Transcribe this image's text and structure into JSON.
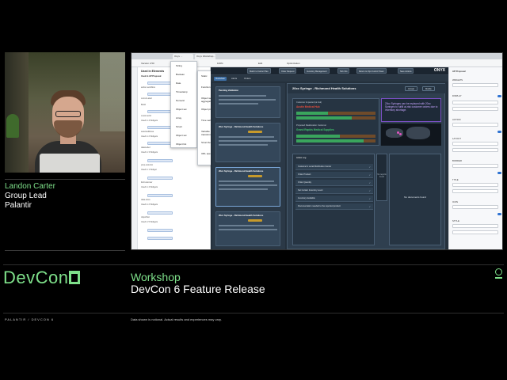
{
  "speaker": {
    "name": "Landon Carter",
    "role": "Group Lead",
    "company": "Palantir"
  },
  "event": {
    "logo_text": "DevCon",
    "session_type": "Workshop",
    "session_title": "DevCon 6 Feature Release"
  },
  "footer": {
    "brand": "PALANTIR  /  DEVCON 6",
    "disclaimer": "Data shown is notional. Actual results and experiences may vary."
  },
  "colors": {
    "accent": "#7ee08a",
    "background": "#000000"
  },
  "screen": {
    "browser_tabs": [
      "Onyx ...",
      "Onyx Workshop..."
    ],
    "toolbar": {
      "version": "Version 2.50",
      "zoom": "100%",
      "edit_label": "Edit",
      "optimization_label": "Optimization"
    },
    "left_panel": {
      "title": "Used in Elements",
      "section": "Used in AP Proposal",
      "rows": [
        "action-workflow",
        "current-alert",
        "Build",
        "customerId",
        "Used in 4 Widgets",
        "selectedRows",
        "Used in 2 Widgets",
        "dateLabel",
        "Used in 3 Widgets",
        "prop-selector",
        "Used in 1 Widget",
        "listCustomer",
        "Used in 4 Widgets",
        "data-store",
        "Used in 2 Widgets",
        "objectSet",
        "Used in 5 Widgets"
      ]
    },
    "context_menu": {
      "items": [
        "String",
        "Boolean",
        "Date",
        "Timestamp",
        "Numeric",
        "Object set",
        "Array",
        "Struct",
        "Object set",
        "Object list"
      ]
    },
    "submenu": {
      "items": [
        "Static",
        "Function",
        "Object set aggregation",
        "Object property",
        "Time series",
        "Variable transformation",
        "Struct field",
        "URL query"
      ]
    },
    "app": {
      "tabs": [
        "Overview",
        "Alerts",
        "Orders"
      ],
      "nav_pills": [
        "Match to Carrier Plan",
        "Order Request",
        "Inventory Management",
        "Hub Info",
        "Return to Ops Control Tower",
        "Save Actions"
      ],
      "brand": "ONYX",
      "panel_title": "AP Proposal",
      "sidebar_cards": [
        {
          "title": "Pending Validation"
        },
        {
          "title": "20cc Syringe - Richmond Health Solutions"
        },
        {
          "title": "20cc Syringe - Richmond Health Solutions"
        },
        {
          "title": "20cc Syringe - Richmond Health Solutions"
        }
      ],
      "proposal_title": "20cc Syringe - Richmond Health Solutions",
      "buttons": {
        "accept": "Accept",
        "modify": "Modify",
        "toggle": "Toggle Notes"
      },
      "customer_label": "Customer Impacted (at risk)",
      "customer_name": "Austin Medical Hub",
      "secondary_label": "Proposed Reallocation Customer",
      "secondary_name": "Grand Rapids Medical Supplies",
      "alert_message": "20cc Syringes can be replaced with 20cc Syringes to fulfill at-risk customer orders due to inventory shortage.",
      "action_log_title": "Action Log",
      "actions": [
        "Customer's Local Distribution Center",
        "Order Product",
        "Order Quantity",
        "Set Certain Inventory Level",
        "Inventory Available",
        "Documentation needed to the reported product"
      ],
      "no_reports": "No reports found",
      "documents_label": "No documents found"
    },
    "right_panel": {
      "title": "AP Proposal",
      "sections": [
        "WIDGETS",
        "DISPLAY",
        "ACTION",
        "LAYOUT",
        "BORDER",
        "TITLE",
        "ICON",
        "STYLE"
      ]
    }
  }
}
